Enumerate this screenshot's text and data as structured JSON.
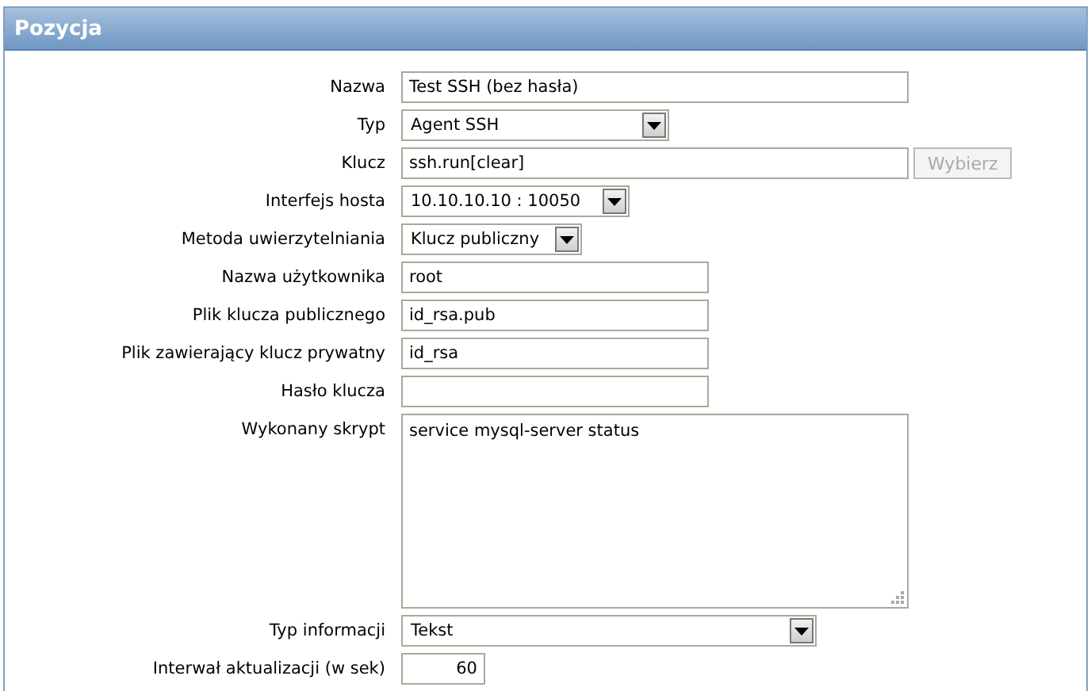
{
  "panel": {
    "title": "Pozycja"
  },
  "fields": [
    {
      "kind": "text",
      "label": "Nazwa",
      "value": "Test SSH (bez hasła)"
    },
    {
      "kind": "select",
      "label": "Typ",
      "value": "Agent SSH"
    },
    {
      "kind": "text_button",
      "label": "Klucz",
      "value": "ssh.run[clear]",
      "button": {
        "label": "Wybierz",
        "disabled": true
      }
    },
    {
      "kind": "select",
      "label": "Interfejs hosta",
      "value": "10.10.10.10 : 10050"
    },
    {
      "kind": "select",
      "label": "Metoda uwierzytelniania",
      "value": "Klucz publiczny"
    },
    {
      "kind": "text",
      "label": "Nazwa użytkownika",
      "value": "root"
    },
    {
      "kind": "text",
      "label": "Plik klucza publicznego",
      "value": "id_rsa.pub"
    },
    {
      "kind": "text",
      "label": "Plik zawierający klucz prywatny",
      "value": "id_rsa"
    },
    {
      "kind": "text",
      "label": "Hasło klucza"
    },
    {
      "kind": "textarea",
      "label": "Wykonany skrypt",
      "value": "service mysql-server status"
    },
    {
      "kind": "select",
      "label": "Typ informacji",
      "value": "Tekst"
    },
    {
      "kind": "number",
      "label": "Interwał aktualizacji (w sek)",
      "value": "60"
    }
  ]
}
